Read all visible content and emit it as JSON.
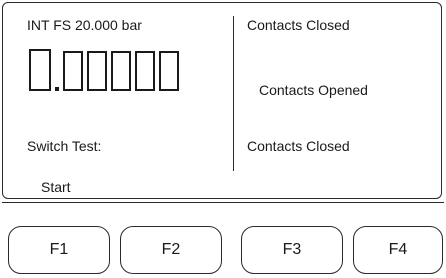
{
  "display": {
    "range_label": "INT FS 20.000 bar",
    "reading": "0.00000",
    "switch_test_label": "Switch Test:",
    "softkey_label": "Start",
    "contacts": [
      {
        "label": "Contacts Closed"
      },
      {
        "label": "Contacts Opened"
      },
      {
        "label": "Contacts Closed"
      }
    ]
  },
  "function_keys": [
    {
      "label": "F1"
    },
    {
      "label": "F2"
    },
    {
      "label": "F3"
    },
    {
      "label": "F4"
    }
  ]
}
